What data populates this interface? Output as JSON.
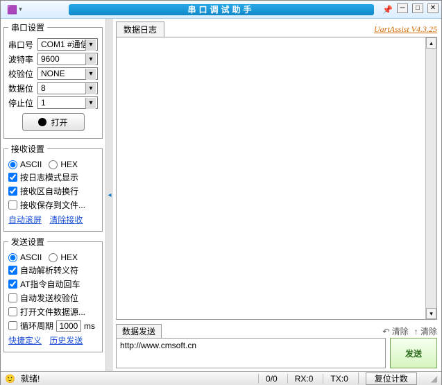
{
  "window": {
    "title": "串口调试助手"
  },
  "brand": "UartAssist V4.3.25",
  "serial": {
    "legend": "串口设置",
    "port_label": "串口号",
    "port_value": "COM1 #通信",
    "baud_label": "波特率",
    "baud_value": "9600",
    "parity_label": "校验位",
    "parity_value": "NONE",
    "data_label": "数据位",
    "data_value": "8",
    "stop_label": "停止位",
    "stop_value": "1",
    "open_label": "打开"
  },
  "recv": {
    "legend": "接收设置",
    "ascii": "ASCII",
    "hex": "HEX",
    "opt1": "按日志模式显示",
    "opt2": "接收区自动换行",
    "opt3": "接收保存到文件...",
    "link1": "自动滚屏",
    "link2": "清除接收"
  },
  "send": {
    "legend": "发送设置",
    "ascii": "ASCII",
    "hex": "HEX",
    "opt1": "自动解析转义符",
    "opt2": "AT指令自动回车",
    "opt3": "自动发送校验位",
    "opt4": "打开文件数据源...",
    "cycle_label": "循环周期",
    "cycle_value": "1000",
    "cycle_unit": "ms",
    "link1": "快捷定义",
    "link2": "历史发送"
  },
  "log": {
    "tab": "数据日志"
  },
  "tx": {
    "tab": "数据发送",
    "clear_link": "清除",
    "clear_btn": "清除",
    "input_value": "http://www.cmsoft.cn",
    "send_btn": "发送"
  },
  "status": {
    "ready": "就绪!",
    "seg1": "0/0",
    "rx": "RX:0",
    "tx": "TX:0",
    "reset": "复位计数"
  }
}
